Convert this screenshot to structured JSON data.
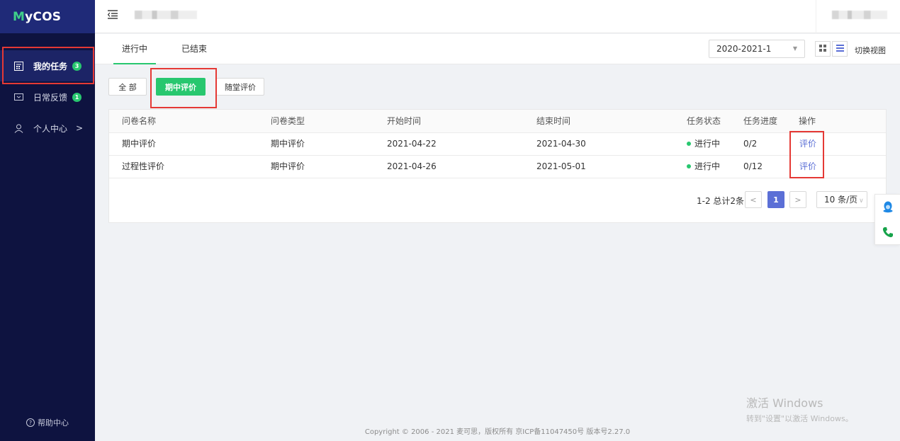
{
  "app": {
    "logo_m": "M",
    "logo_rest": "yCOS"
  },
  "sidebar": {
    "items": [
      {
        "label": "我的任务",
        "badge": "3",
        "icon": "calendar-icon"
      },
      {
        "label": "日常反馈",
        "badge": "1",
        "icon": "feedback-icon"
      },
      {
        "label": "个人中心",
        "arrow": ">",
        "icon": "user-icon"
      }
    ],
    "help": "帮助中心"
  },
  "tabs": [
    {
      "label": "进行中",
      "active": true
    },
    {
      "label": "已结束",
      "active": false
    }
  ],
  "toolbar": {
    "term": "2020-2021-1",
    "switch_view": "切换视图"
  },
  "filters": [
    {
      "label": "全 部",
      "active": false
    },
    {
      "label": "期中评价",
      "active": true
    },
    {
      "label": "随堂评价",
      "active": false
    }
  ],
  "table": {
    "headers": [
      "问卷名称",
      "问卷类型",
      "开始时间",
      "结束时间",
      "任务状态",
      "任务进度",
      "操作"
    ],
    "rows": [
      {
        "name": "期中评价",
        "type": "期中评价",
        "start": "2021-04-22",
        "end": "2021-04-30",
        "status": "进行中",
        "progress": "0/2",
        "action": "评价"
      },
      {
        "name": "过程性评价",
        "type": "期中评价",
        "start": "2021-04-26",
        "end": "2021-05-01",
        "status": "进行中",
        "progress": "0/12",
        "action": "评价"
      }
    ]
  },
  "pagination": {
    "info": "1-2 总计2条",
    "prev": "<",
    "current": "1",
    "next": ">",
    "page_size": "10 条/页"
  },
  "watermark": {
    "line1": "激活 Windows",
    "line2": "转到\"设置\"以激活 Windows。"
  },
  "footer": "Copyright © 2006 - 2021 麦可思，版权所有 京ICP备11047450号 版本号2.27.0",
  "colors": {
    "sidebar_bg": "#0e1340",
    "accent_green": "#28c76f",
    "link_blue": "#5b6fd6",
    "annotation_red": "#e53935"
  }
}
